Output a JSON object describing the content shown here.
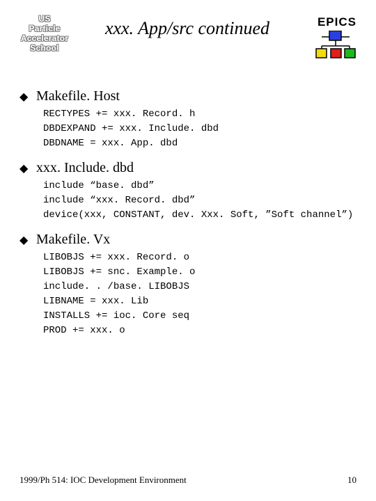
{
  "header": {
    "uspas_line1": "US",
    "uspas_line2": "Particle",
    "uspas_line3": "Accelerator",
    "uspas_line4": "School",
    "title": "xxx. App/src continued",
    "epics_label": "EPICS"
  },
  "sections": [
    {
      "heading": "Makefile. Host",
      "code": [
        "RECTYPES += xxx. Record. h",
        "DBDEXPAND += xxx. Include. dbd",
        "DBDNAME = xxx. App. dbd"
      ]
    },
    {
      "heading": "xxx. Include. dbd",
      "code": [
        "include “base. dbd”",
        "include “xxx. Record. dbd”",
        "device(xxx, CONSTANT, dev. Xxx. Soft, ”Soft channel”)"
      ]
    },
    {
      "heading": "Makefile. Vx",
      "code": [
        "LIBOBJS += xxx. Record. o",
        "LIBOBJS += snc. Example. o",
        "include. . /base. LIBOBJS",
        "LIBNAME = xxx. Lib",
        "INSTALLS += ioc. Core seq",
        "PROD += xxx. o"
      ]
    }
  ],
  "footer": {
    "left": "1999/Ph 514: IOC Development Environment",
    "page": "10"
  },
  "colors": {
    "epics_blue": "#2a3fe0",
    "epics_yellow": "#f2db11",
    "epics_red": "#e01f1f",
    "epics_green": "#1db81d",
    "epics_stroke": "#000"
  }
}
